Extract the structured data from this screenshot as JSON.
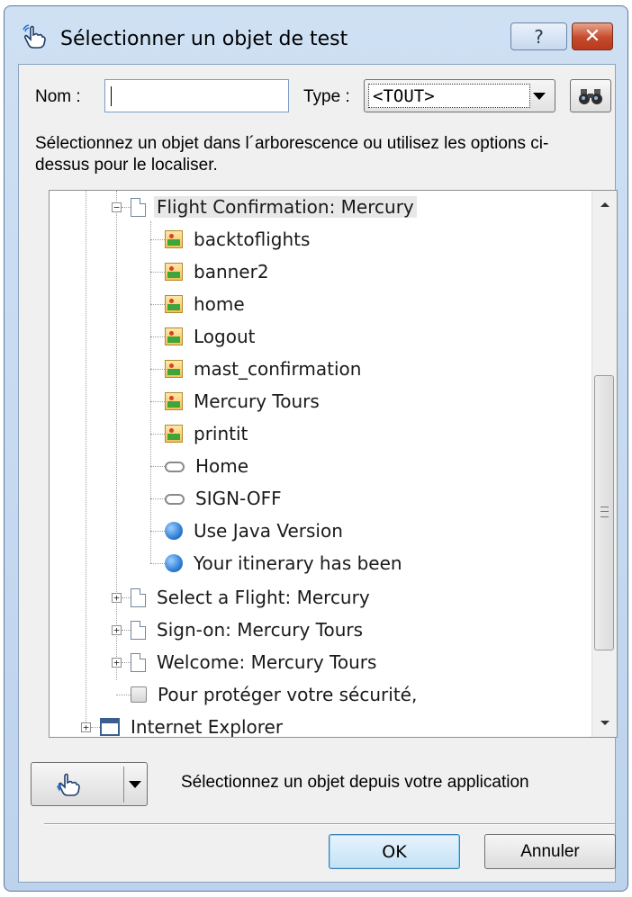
{
  "window": {
    "title": "Sélectionner un objet de test",
    "help_glyph": "?",
    "close_glyph": "✕"
  },
  "search": {
    "nom_label": "Nom :",
    "nom_value": "",
    "type_label": "Type :",
    "type_value": "<TOUT>"
  },
  "instructions": "Sélectionnez un objet dans l´arborescence ou utilisez les options ci-dessus pour le localiser.",
  "tree": {
    "items": [
      {
        "label": "Flight Confirmation: Mercury",
        "icon": "page-icon",
        "expander": "−"
      },
      {
        "label": "backtoflights",
        "icon": "image-icon"
      },
      {
        "label": "banner2",
        "icon": "image-icon"
      },
      {
        "label": "home",
        "icon": "image-icon"
      },
      {
        "label": "Logout",
        "icon": "image-icon"
      },
      {
        "label": "mast_confirmation",
        "icon": "image-icon"
      },
      {
        "label": "Mercury Tours",
        "icon": "image-icon"
      },
      {
        "label": "printit",
        "icon": "image-icon"
      },
      {
        "label": "Home",
        "icon": "link-icon"
      },
      {
        "label": "SIGN-OFF",
        "icon": "link-icon"
      },
      {
        "label": "Use Java Version",
        "icon": "web-element-icon"
      },
      {
        "label": "Your itinerary has been",
        "icon": "web-element-icon"
      },
      {
        "label": "Select a Flight: Mercury",
        "icon": "page-icon",
        "expander": "+"
      },
      {
        "label": "Sign-on: Mercury Tours",
        "icon": "page-icon",
        "expander": "+"
      },
      {
        "label": "Welcome: Mercury Tours",
        "icon": "page-icon",
        "expander": "+"
      },
      {
        "label": "Pour protéger votre sécurité,",
        "icon": "dialog-icon"
      },
      {
        "label": "Internet Explorer",
        "icon": "window-icon",
        "expander": "+"
      }
    ]
  },
  "picker": {
    "label": "Sélectionnez un objet depuis votre application"
  },
  "buttons": {
    "ok": "OK",
    "cancel": "Annuler"
  },
  "colors": {
    "title_bg": "#c9dcf2",
    "close_red": "#c64a2c",
    "ok_border": "#3c7fb1"
  }
}
